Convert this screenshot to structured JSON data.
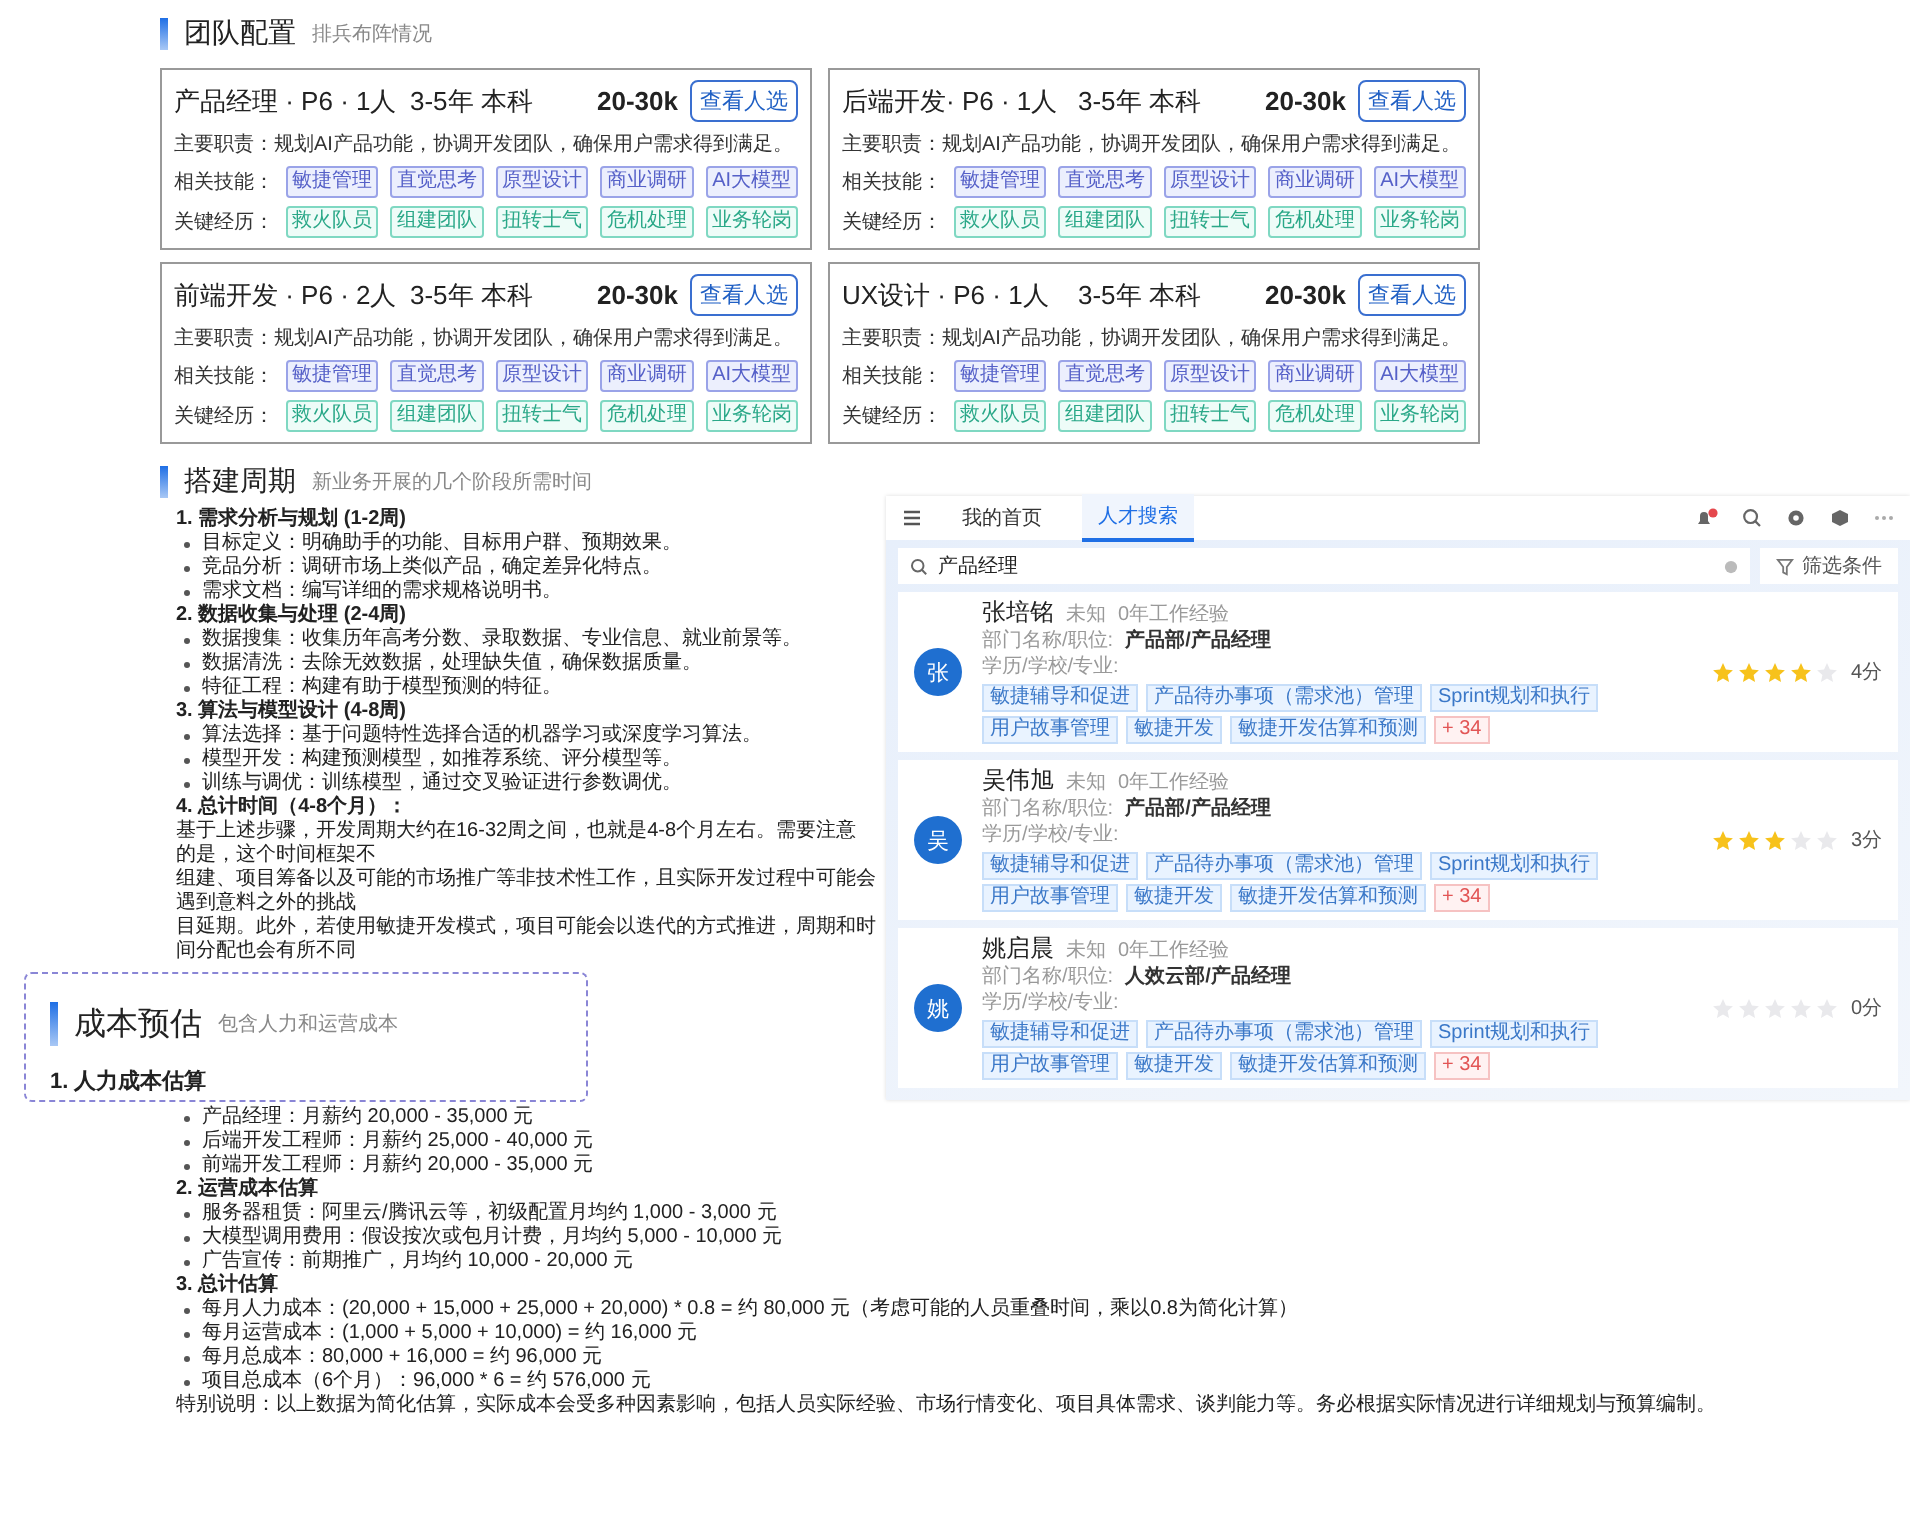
{
  "team_section": {
    "title": "团队配置",
    "subtitle": "排兵布阵情况",
    "cards": [
      {
        "role": "产品经理 · P6 · 1人",
        "requirement": "3-5年 本科",
        "salary": "20-30k",
        "button": "查看人选",
        "duty_label": "主要职责：",
        "duty": "规划AI产品功能，协调开发团队，确保用户需求得到满足。",
        "skills_label": "相关技能：",
        "skills": [
          "敏捷管理",
          "直觉思考",
          "原型设计",
          "商业调研",
          "AI大模型"
        ],
        "experience_label": "关键经历：",
        "experience": [
          "救火队员",
          "组建团队",
          "扭转士气",
          "危机处理",
          "业务轮岗"
        ]
      },
      {
        "role": "后端开发· P6 · 1人",
        "requirement": "3-5年 本科",
        "salary": "20-30k",
        "button": "查看人选",
        "duty_label": "主要职责：",
        "duty": "规划AI产品功能，协调开发团队，确保用户需求得到满足。",
        "skills_label": "相关技能：",
        "skills": [
          "敏捷管理",
          "直觉思考",
          "原型设计",
          "商业调研",
          "AI大模型"
        ],
        "experience_label": "关键经历：",
        "experience": [
          "救火队员",
          "组建团队",
          "扭转士气",
          "危机处理",
          "业务轮岗"
        ]
      },
      {
        "role": "前端开发 · P6 · 2人",
        "requirement": "3-5年 本科",
        "salary": "20-30k",
        "button": "查看人选",
        "duty_label": "主要职责：",
        "duty": "规划AI产品功能，协调开发团队，确保用户需求得到满足。",
        "skills_label": "相关技能：",
        "skills": [
          "敏捷管理",
          "直觉思考",
          "原型设计",
          "商业调研",
          "AI大模型"
        ],
        "experience_label": "关键经历：",
        "experience": [
          "救火队员",
          "组建团队",
          "扭转士气",
          "危机处理",
          "业务轮岗"
        ]
      },
      {
        "role": "UX设计 · P6 · 1人",
        "requirement": "3-5年 本科",
        "salary": "20-30k",
        "button": "查看人选",
        "duty_label": "主要职责：",
        "duty": "规划AI产品功能，协调开发团队，确保用户需求得到满足。",
        "skills_label": "相关技能：",
        "skills": [
          "敏捷管理",
          "直觉思考",
          "原型设计",
          "商业调研",
          "AI大模型"
        ],
        "experience_label": "关键经历：",
        "experience": [
          "救火队员",
          "组建团队",
          "扭转士气",
          "危机处理",
          "业务轮岗"
        ]
      }
    ]
  },
  "cycle_section": {
    "title": "搭建周期",
    "subtitle": "新业务开展的几个阶段所需时间",
    "phases": [
      {
        "heading": "1. 需求分析与规划 (1-2周)",
        "items": [
          "目标定义：明确助手的功能、目标用户群、预期效果。",
          "竞品分析：调研市场上类似产品，确定差异化特点。",
          "需求文档：编写详细的需求规格说明书。"
        ]
      },
      {
        "heading": "2. 数据收集与处理 (2-4周)",
        "items": [
          "数据搜集：收集历年高考分数、录取数据、专业信息、就业前景等。",
          "数据清洗：去除无效数据，处理缺失值，确保数据质量。",
          "特征工程：构建有助于模型预测的特征。"
        ]
      },
      {
        "heading": "3. 算法与模型设计 (4-8周)",
        "items": [
          "算法选择：基于问题特性选择合适的机器学习或深度学习算法。",
          "模型开发：构建预测模型，如推荐系统、评分模型等。",
          "训练与调优：训练模型，通过交叉验证进行参数调优。"
        ]
      },
      {
        "heading": "4. 总计时间（4-8个月）："
      }
    ],
    "summary_lines": [
      "基于上述步骤，开发周期大约在16-32周之间，也就是4-8个月左右。需要注意的是，这个时间框架不",
      "组建、项目筹备以及可能的市场推广等非技术性工作，且实际开发过程中可能会遇到意料之外的挑战",
      "目延期。此外，若使用敏捷开发模式，项目可能会以迭代的方式推进，周期和时间分配也会有所不同"
    ]
  },
  "talent_window": {
    "nav_tabs": [
      {
        "label": "我的首页",
        "selected": false
      },
      {
        "label": "人才搜索",
        "selected": true
      }
    ],
    "search": {
      "value": "产品经理"
    },
    "filter_button": "筛选条件",
    "candidates": [
      {
        "avatar": "张",
        "name": "张培铭",
        "gender": "未知",
        "experience": "0年工作经验",
        "dept_label": "部门名称/职位:",
        "dept": "产品部/产品经理",
        "edu_label": "学历/学校/专业:",
        "tags": [
          "敏捷辅导和促进",
          "产品待办事项（需求池）管理",
          "Sprint规划和执行",
          "用户故事管理",
          "敏捷开发",
          "敏捷开发估算和预测"
        ],
        "more": "+ 34",
        "stars": 4,
        "score": "4分"
      },
      {
        "avatar": "吴",
        "name": "吴伟旭",
        "gender": "未知",
        "experience": "0年工作经验",
        "dept_label": "部门名称/职位:",
        "dept": "产品部/产品经理",
        "edu_label": "学历/学校/专业:",
        "tags": [
          "敏捷辅导和促进",
          "产品待办事项（需求池）管理",
          "Sprint规划和执行",
          "用户故事管理",
          "敏捷开发",
          "敏捷开发估算和预测"
        ],
        "more": "+ 34",
        "stars": 3,
        "score": "3分"
      },
      {
        "avatar": "姚",
        "name": "姚启晨",
        "gender": "未知",
        "experience": "0年工作经验",
        "dept_label": "部门名称/职位:",
        "dept": "人效云部/产品经理",
        "edu_label": "学历/学校/专业:",
        "tags": [
          "敏捷辅导和促进",
          "产品待办事项（需求池）管理",
          "Sprint规划和执行",
          "用户故事管理",
          "敏捷开发",
          "敏捷开发估算和预测"
        ],
        "more": "+ 34",
        "stars": 0,
        "score": "0分"
      }
    ]
  },
  "cost_section": {
    "title": "成本预估",
    "subtitle": "包含人力和运营成本",
    "groups": [
      {
        "heading": "1. 人力成本估算",
        "items": [
          "产品经理：月薪约 20,000 - 35,000 元",
          "后端开发工程师：月薪约 25,000 - 40,000 元",
          "前端开发工程师：月薪约 20,000 - 35,000 元"
        ]
      },
      {
        "heading": "2. 运营成本估算",
        "items": [
          "服务器租赁：阿里云/腾讯云等，初级配置月均约 1,000 - 3,000 元",
          "大模型调用费用：假设按次或包月计费，月均约 5,000 - 10,000 元",
          "广告宣传：前期推广，月均约 10,000 - 20,000 元"
        ]
      },
      {
        "heading": "3. 总计估算",
        "items": [
          "每月人力成本：(20,000 + 15,000 + 25,000 + 20,000) * 0.8 = 约 80,000 元（考虑可能的人员重叠时间，乘以0.8为简化计算）",
          "每月运营成本：(1,000 + 5,000 + 10,000) = 约 16,000 元",
          "每月总成本：80,000 + 16,000 = 约 96,000 元",
          "项目总成本（6个月）：96,000 * 6 = 约 576,000 元"
        ]
      }
    ],
    "note": "特别说明：以上数据为简化估算，实际成本会受多种因素影响，包括人员实际经验、市场行情变化、项目具体需求、谈判能力等。务必根据实际情况进行详细规划与预算编制。"
  }
}
